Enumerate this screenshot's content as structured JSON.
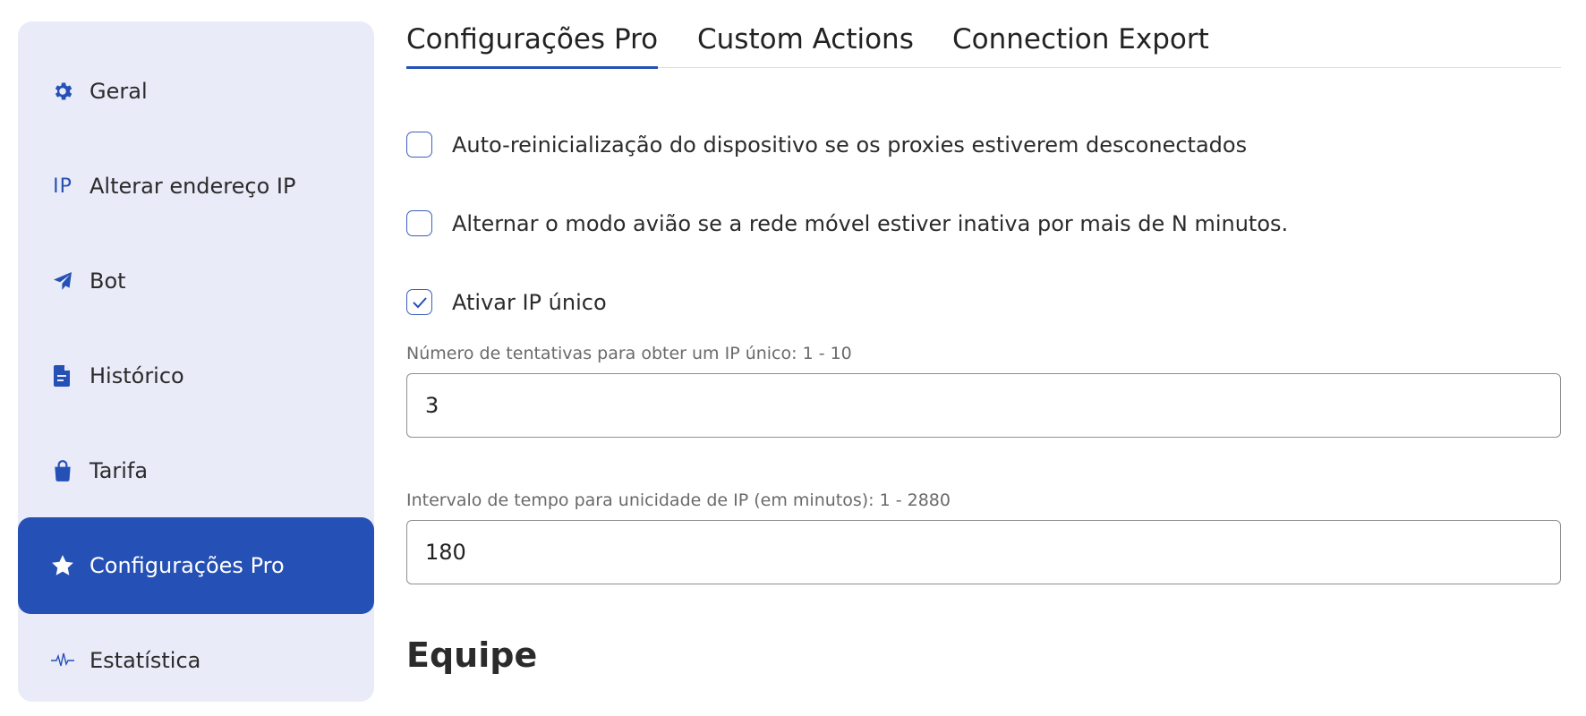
{
  "sidebar": {
    "items": [
      {
        "label": "Geral",
        "icon": "gear-icon"
      },
      {
        "label": "Alterar endereço IP",
        "icon": "ip-icon",
        "icon_text": "IP"
      },
      {
        "label": "Bot",
        "icon": "paper-plane-icon"
      },
      {
        "label": "Histórico",
        "icon": "document-icon"
      },
      {
        "label": "Tarifa",
        "icon": "shopping-bag-icon"
      },
      {
        "label": "Configurações Pro",
        "icon": "star-icon",
        "active": true
      },
      {
        "label": "Estatística",
        "icon": "pulse-icon"
      }
    ]
  },
  "tabs": [
    {
      "label": "Configurações Pro",
      "active": true
    },
    {
      "label": "Custom Actions",
      "active": false
    },
    {
      "label": "Connection Export",
      "active": false
    }
  ],
  "options": [
    {
      "label": "Auto-reinicialização do dispositivo se os proxies estiverem desconectados",
      "checked": false
    },
    {
      "label": "Alternar o modo avião se a rede móvel estiver inativa por mais de N minutos.",
      "checked": false
    },
    {
      "label": "Ativar IP único",
      "checked": true
    }
  ],
  "fields": [
    {
      "label": "Número de tentativas para obter um IP único: 1 - 10",
      "value": "3"
    },
    {
      "label": "Intervalo de tempo para unicidade de IP (em minutos): 1 - 2880",
      "value": "180"
    }
  ],
  "section": {
    "title": "Equipe"
  },
  "colors": {
    "accent": "#2550b5",
    "sidebar_bg": "#e9ebf8",
    "text": "#2b2b2b",
    "muted": "#6a6a6a"
  }
}
